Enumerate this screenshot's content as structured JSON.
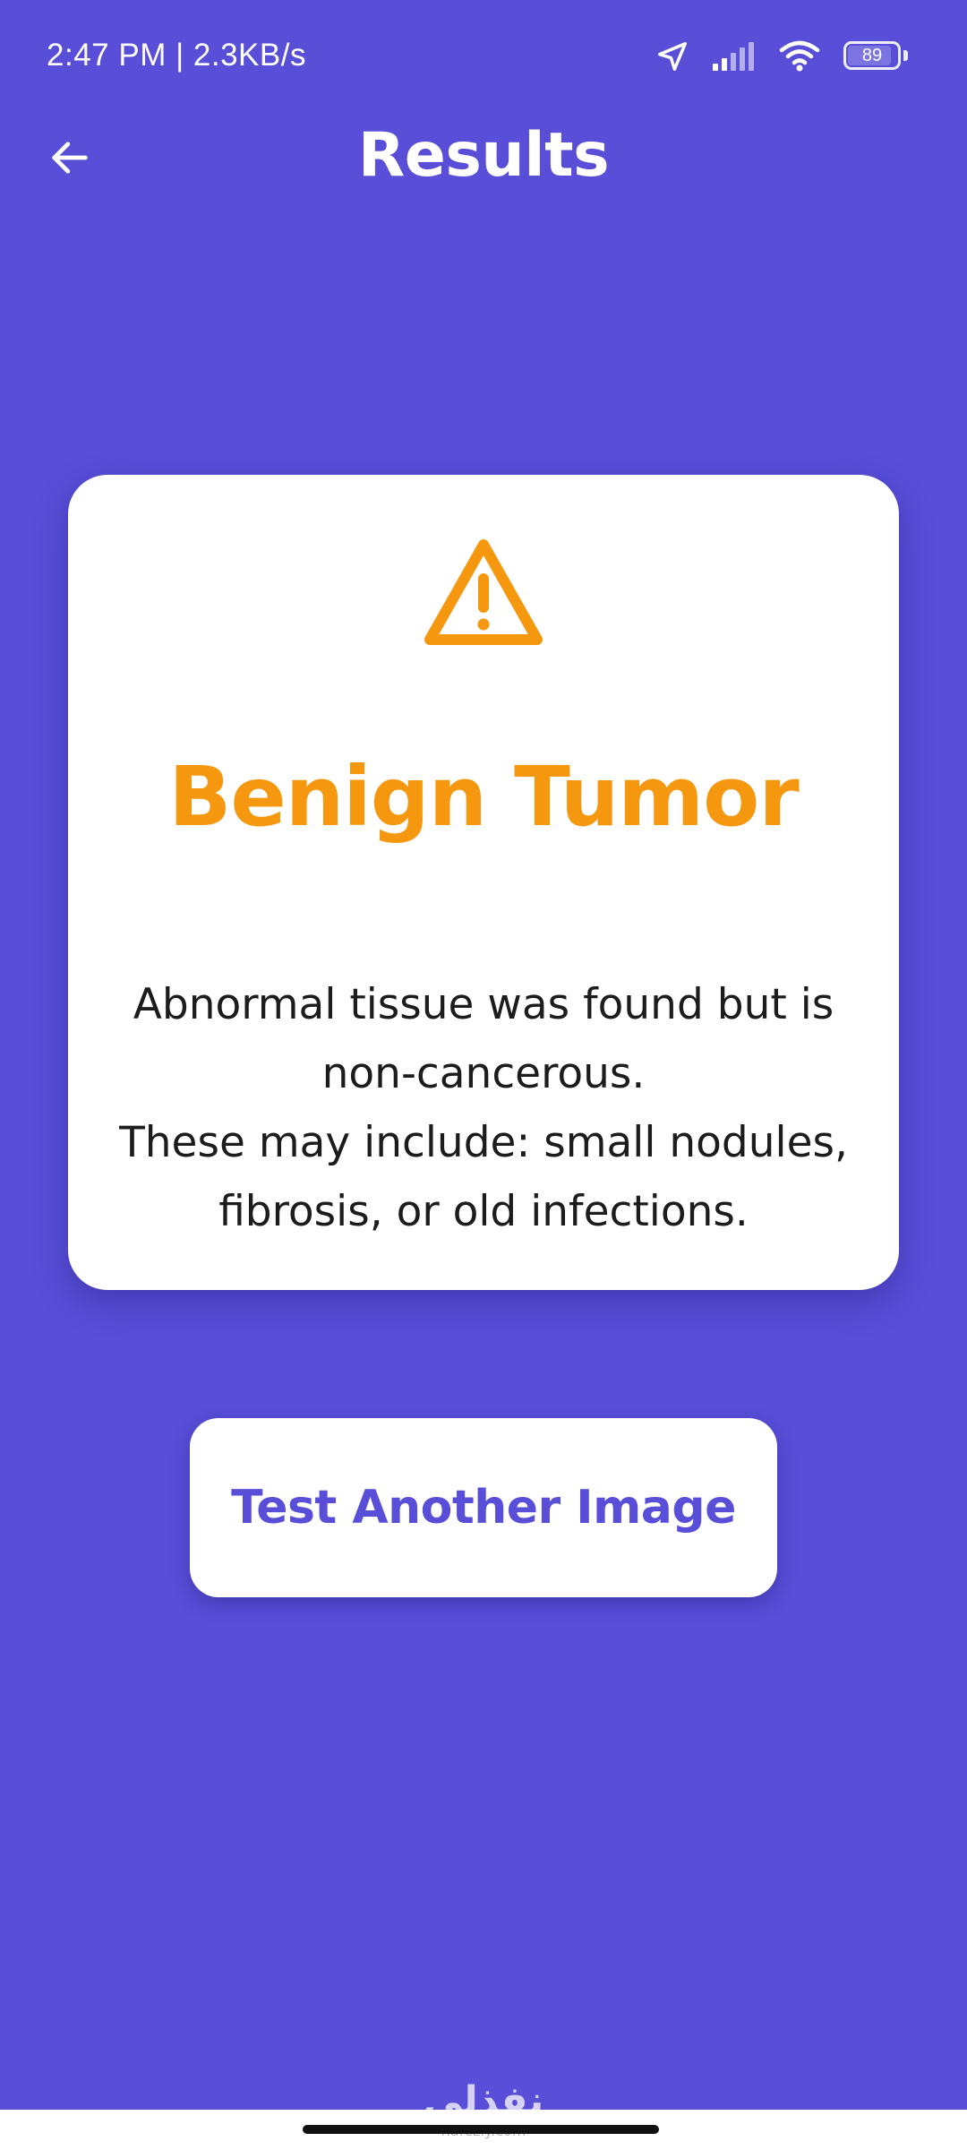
{
  "status_bar": {
    "time_speed": "2:47 PM | 2.3KB/s",
    "battery_level": "89",
    "battery_fraction": 0.89,
    "icons": [
      "location-arrow-icon",
      "signal-icon",
      "wifi-icon",
      "battery-icon"
    ]
  },
  "header": {
    "title": "Results",
    "back_icon": "arrow-left-icon"
  },
  "result": {
    "icon": "warning-triangle-icon",
    "title": "Benign Tumor",
    "description_lines": [
      "Abnormal tissue was found but is",
      "non-cancerous.",
      "These may include: small nodules,",
      "fibrosis, or old infections."
    ]
  },
  "actions": {
    "test_another_label": "Test Another Image"
  },
  "watermark": {
    "text": "نفذلي",
    "subtext": "nafezly.com"
  },
  "colors": {
    "background": "#584ED8",
    "accent_warning": "#F6980F",
    "card": "#FFFFFF",
    "button_text": "#584ED8"
  }
}
